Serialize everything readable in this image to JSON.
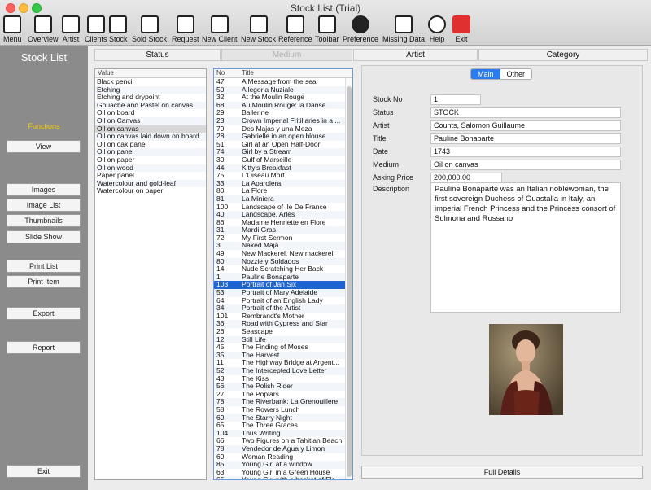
{
  "window": {
    "title": "Stock List (Trial)"
  },
  "toolbar": [
    {
      "label": "Menu",
      "icon": "menu-icon"
    },
    {
      "label": "Overview",
      "icon": "document-icon"
    },
    {
      "label": "Artist",
      "icon": "person-icon"
    },
    {
      "label": "Clients",
      "icon": "group-icon"
    },
    {
      "label": "Stock",
      "icon": "picture-icon"
    },
    {
      "label": "Sold Stock",
      "icon": "sold-picture-icon"
    },
    {
      "label": "Request",
      "icon": "easel-icon"
    },
    {
      "label": "New Client",
      "icon": "add-person-icon"
    },
    {
      "label": "New Stock",
      "icon": "add-picture-icon"
    },
    {
      "label": "Reference",
      "icon": "books-icon"
    },
    {
      "label": "Toolbar",
      "icon": "tools-icon"
    },
    {
      "label": "Preference",
      "icon": "gear-icon"
    },
    {
      "label": "Missing Data",
      "icon": "missing-data-icon"
    },
    {
      "label": "Help",
      "icon": "help-icon"
    },
    {
      "label": "Exit",
      "icon": "close-icon"
    }
  ],
  "sidebar": {
    "title": "Stock List",
    "functions_label": "Functions",
    "buttons": [
      "View",
      "Images",
      "Image List",
      "Thumbnails",
      "Slide Show",
      "Print List",
      "Print Item",
      "Export",
      "Report",
      "Exit"
    ]
  },
  "columns": {
    "status": "Status",
    "medium": "Medium",
    "artist": "Artist",
    "category": "Category"
  },
  "value_list": {
    "header": "Value",
    "items": [
      "Black pencil",
      "Etching",
      "Etching and drypoint",
      "Gouache and Pastel on canvas",
      "Oil on board",
      "Oil on Canvas",
      "Oil on canvas",
      "Oil on canvas laid down on board",
      "Oil on oak panel",
      "Oil on panel",
      "Oil on paper",
      "Oil on wood",
      "Paper panel",
      "Watercolour and gold-leaf",
      "Watercolour on paper"
    ],
    "selected_index": 6
  },
  "stock_list": {
    "header_no": "No",
    "header_title": "Title",
    "selected_index": 26,
    "rows": [
      {
        "no": "47",
        "title": "A Message from the sea"
      },
      {
        "no": "50",
        "title": "Allegoria Nuziale"
      },
      {
        "no": "32",
        "title": "At the Moulin Rouge"
      },
      {
        "no": "68",
        "title": "Au Moulin Rouge: la Danse"
      },
      {
        "no": "29",
        "title": "Ballerine"
      },
      {
        "no": "23",
        "title": "Crown Imperial Fritillaries in a ..."
      },
      {
        "no": "79",
        "title": "Des Majas y una Meza"
      },
      {
        "no": "28",
        "title": "Gabrielle in an open blouse"
      },
      {
        "no": "51",
        "title": "Girl at an Open Half-Door"
      },
      {
        "no": "74",
        "title": "Girl by a Stream"
      },
      {
        "no": "30",
        "title": "Gulf of Marseille"
      },
      {
        "no": "44",
        "title": "Kitty's Breakfast"
      },
      {
        "no": "75",
        "title": "L'Oiseau Mort"
      },
      {
        "no": "33",
        "title": "La Aparolera"
      },
      {
        "no": "80",
        "title": "La Flore"
      },
      {
        "no": "81",
        "title": "La Miniera"
      },
      {
        "no": "100",
        "title": "Landscape of Ile De France"
      },
      {
        "no": "40",
        "title": "Landscape, Arles"
      },
      {
        "no": "86",
        "title": "Madame Henriette en Flore"
      },
      {
        "no": "31",
        "title": "Mardi Gras"
      },
      {
        "no": "72",
        "title": "My First Sermon"
      },
      {
        "no": "3",
        "title": "Naked Maja"
      },
      {
        "no": "49",
        "title": "New Mackerel, New mackerel"
      },
      {
        "no": "80",
        "title": "Nozzie y Soldados"
      },
      {
        "no": "14",
        "title": "Nude Scratching Her Back"
      },
      {
        "no": "1",
        "title": "Pauline Bonaparte"
      },
      {
        "no": "103",
        "title": "Portrait of Jan Six"
      },
      {
        "no": "53",
        "title": "Portrait of Mary Adelaide"
      },
      {
        "no": "64",
        "title": "Portrait of an English Lady"
      },
      {
        "no": "34",
        "title": "Portrait of the Artist"
      },
      {
        "no": "101",
        "title": "Rembrandt's Mother"
      },
      {
        "no": "36",
        "title": "Road with Cypress and Star"
      },
      {
        "no": "26",
        "title": "Seascape"
      },
      {
        "no": "12",
        "title": "Still Life"
      },
      {
        "no": "45",
        "title": "The Finding of Moses"
      },
      {
        "no": "35",
        "title": "The Harvest"
      },
      {
        "no": "11",
        "title": "The Highway Bridge at Argent..."
      },
      {
        "no": "52",
        "title": "The Intercepted Love Letter"
      },
      {
        "no": "43",
        "title": "The Kiss"
      },
      {
        "no": "56",
        "title": "The Polish Rider"
      },
      {
        "no": "27",
        "title": "The Poplars"
      },
      {
        "no": "78",
        "title": "The Riverbank: La Grenouillere"
      },
      {
        "no": "58",
        "title": "The Rowers Lunch"
      },
      {
        "no": "69",
        "title": "The Starry Night"
      },
      {
        "no": "65",
        "title": "The Three Graces"
      },
      {
        "no": "104",
        "title": "Thus Writing"
      },
      {
        "no": "66",
        "title": "Two Figures on a Tahitian Beach"
      },
      {
        "no": "78",
        "title": "Vendedor de Agua y Limon"
      },
      {
        "no": "69",
        "title": "Woman Reading"
      },
      {
        "no": "85",
        "title": "Young Girl at a window"
      },
      {
        "no": "63",
        "title": "Young Girl in a Green House"
      },
      {
        "no": "65",
        "title": "Young Girl with a basket of Flo..."
      }
    ]
  },
  "detail": {
    "tabs": [
      "Main",
      "Other"
    ],
    "active_tab": "Main",
    "fields": [
      {
        "label": "Stock No",
        "value": "1"
      },
      {
        "label": "Status",
        "value": "STOCK"
      },
      {
        "label": "Artist",
        "value": "Counts, Salomon Guillaume"
      },
      {
        "label": "Title",
        "value": "Pauline Bonaparte"
      },
      {
        "label": "Date",
        "value": "1743"
      },
      {
        "label": "Medium",
        "value": "Oil on canvas"
      },
      {
        "label": "Asking Price",
        "value": "200,000.00"
      }
    ],
    "description_label": "Description",
    "description": "Pauline Bonaparte was an Italian noblewoman, the first sovereign Duchess of Guastalla in Italy, an imperial French Princess and the Princess consort of Sulmona and Rossano",
    "full_details": "Full Details"
  },
  "colors": {
    "selection": "#1c63d4",
    "sidebar": "#8b8b8b",
    "functions": "#f5d000",
    "exit_red": "#e03030"
  }
}
